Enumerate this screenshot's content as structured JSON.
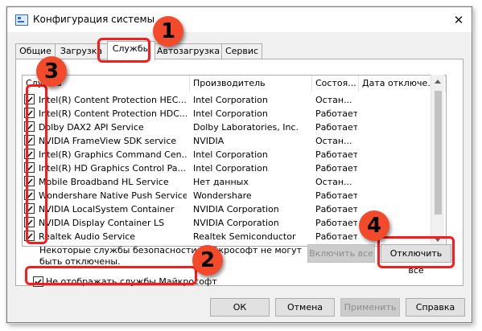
{
  "window": {
    "title": "Конфигурация системы",
    "close_glyph": "✕"
  },
  "tabs": [
    {
      "label": "Общие"
    },
    {
      "label": "Загрузка"
    },
    {
      "label": "Службы"
    },
    {
      "label": "Автозагрузка"
    },
    {
      "label": "Сервис"
    }
  ],
  "active_tab": "Службы",
  "table": {
    "columns": [
      "Служба",
      "Производитель",
      "Состоя...",
      "Дата отключе..."
    ],
    "rows": [
      {
        "checked": true,
        "service": "Intel(R) Content Protection HEC...",
        "manufacturer": "Intel Corporation",
        "status": "Остан..."
      },
      {
        "checked": true,
        "service": "Intel(R) Content Protection HDC...",
        "manufacturer": "Intel Corporation",
        "status": "Работает"
      },
      {
        "checked": true,
        "service": "Dolby DAX2 API Service",
        "manufacturer": "Dolby Laboratories, Inc.",
        "status": "Работает"
      },
      {
        "checked": true,
        "service": "NVIDIA FrameView SDK service",
        "manufacturer": "NVIDIA",
        "status": "Остан..."
      },
      {
        "checked": true,
        "service": "Intel(R) Graphics Command Cen...",
        "manufacturer": "Intel Corporation",
        "status": "Работает"
      },
      {
        "checked": true,
        "service": "Intel(R) HD Graphics Control Pa...",
        "manufacturer": "Intel Corporation",
        "status": "Работает"
      },
      {
        "checked": true,
        "service": "Mobile Broadband HL Service",
        "manufacturer": "Нет данных",
        "status": "Остан..."
      },
      {
        "checked": true,
        "service": "Wondershare Native Push Service",
        "manufacturer": "Wondershare",
        "status": "Работает"
      },
      {
        "checked": true,
        "service": "NVIDIA LocalSystem Container",
        "manufacturer": "NVIDIA Corporation",
        "status": "Работает"
      },
      {
        "checked": true,
        "service": "NVIDIA Display Container LS",
        "manufacturer": "NVIDIA Corporation",
        "status": "Работает"
      },
      {
        "checked": true,
        "service": "Realtek Audio Service",
        "manufacturer": "Realtek Semiconductor",
        "status": "Работает"
      }
    ]
  },
  "notice": "Некоторые службы безопасности Майкрософт не могут быть отключены.",
  "buttons": {
    "enable_all": "Включить все",
    "disable_all": "Отключить все",
    "ok": "ОК",
    "cancel": "Отмена",
    "apply": "Применить",
    "help": "Справка"
  },
  "hide_ms": {
    "label": "Не отображать службы Майкрософт",
    "checked": true
  },
  "markers": [
    "1",
    "2",
    "3",
    "4"
  ],
  "colors": {
    "highlight": "#ff1a1a",
    "marker": "#f24a2a"
  }
}
